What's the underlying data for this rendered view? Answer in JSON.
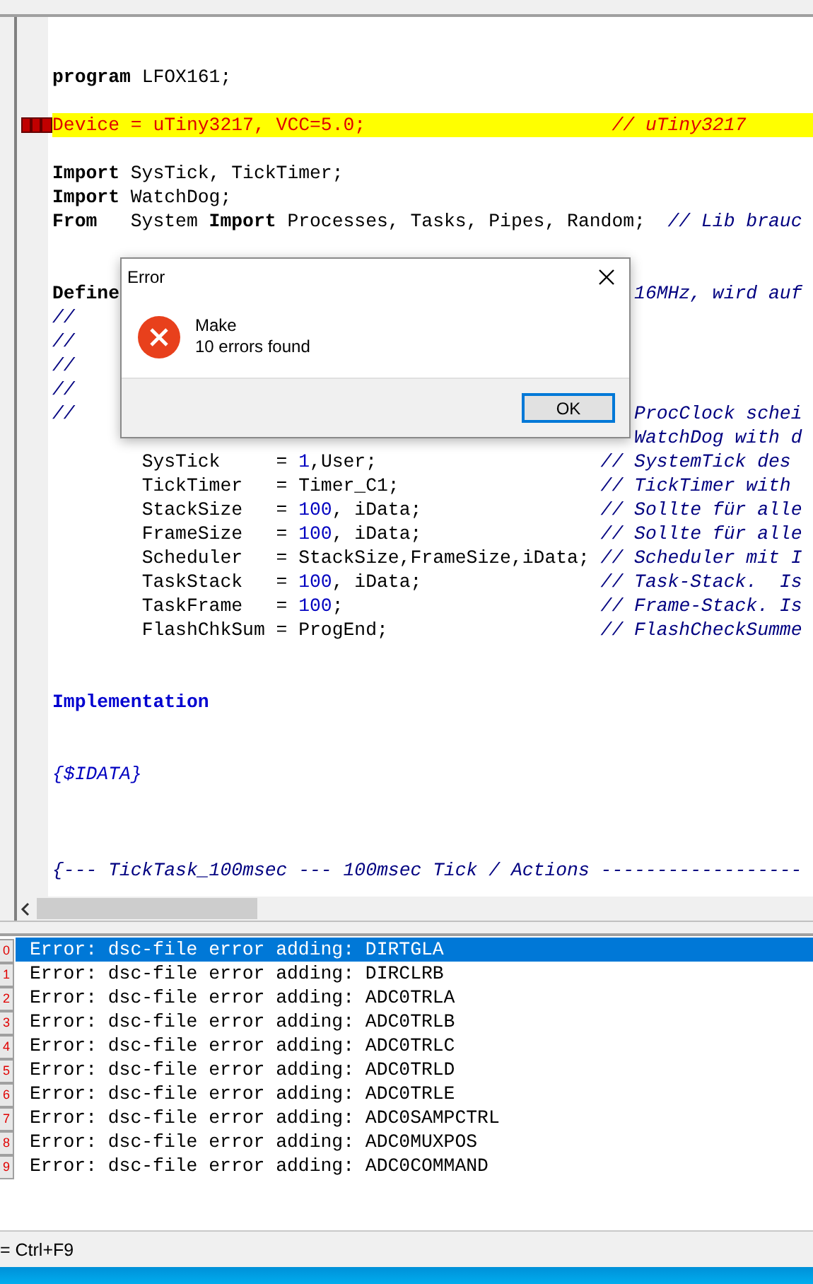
{
  "editor": {
    "lines": [
      {
        "kind": "blank"
      },
      {
        "kind": "blank"
      },
      {
        "kind": "code",
        "error": false,
        "runs": [
          {
            "parts": [
              {
                "kind": "kw",
                "text": "program"
              },
              {
                "kind": "plain",
                "text": " LFOX161;"
              }
            ]
          }
        ]
      },
      {
        "kind": "blank"
      },
      {
        "kind": "code",
        "error": true,
        "runs": [
          {
            "parts": [
              {
                "kind": "plain",
                "text": "Device = uTiny3217, VCC=5.0;                      "
              },
              {
                "kind": "cm",
                "text": "// uTiny3217"
              }
            ]
          }
        ]
      },
      {
        "kind": "blank"
      },
      {
        "kind": "code",
        "error": false,
        "runs": [
          {
            "parts": [
              {
                "kind": "kw",
                "text": "Import"
              },
              {
                "kind": "plain",
                "text": " SysTick, TickTimer;"
              }
            ]
          }
        ]
      },
      {
        "kind": "code",
        "error": false,
        "runs": [
          {
            "parts": [
              {
                "kind": "kw",
                "text": "Import"
              },
              {
                "kind": "plain",
                "text": " WatchDog;"
              }
            ]
          }
        ]
      },
      {
        "kind": "code",
        "error": false,
        "runs": [
          {
            "parts": [
              {
                "kind": "kw",
                "text": "From"
              },
              {
                "kind": "plain",
                "text": "   System "
              },
              {
                "kind": "kw",
                "text": "Import"
              },
              {
                "kind": "plain",
                "text": " Processes, Tasks, Pipes, Random;  "
              },
              {
                "kind": "cm",
                "text": "// Lib brauc"
              }
            ]
          }
        ]
      },
      {
        "kind": "blank"
      },
      {
        "kind": "blank"
      },
      {
        "kind": "code",
        "error": false,
        "runs": [
          {
            "parts": [
              {
                "kind": "kw",
                "text": "Define"
              }
            ]
          },
          {
            "parts": [
              {
                "kind": "cm",
                "text": "                                              16MHz, wird auf"
              }
            ]
          }
        ]
      },
      {
        "kind": "code",
        "error": false,
        "runs": [
          {
            "parts": [
              {
                "kind": "cm",
                "text": "//"
              }
            ]
          }
        ]
      },
      {
        "kind": "code",
        "error": false,
        "runs": [
          {
            "parts": [
              {
                "kind": "cm",
                "text": "//"
              }
            ]
          }
        ]
      },
      {
        "kind": "code",
        "error": false,
        "runs": [
          {
            "parts": [
              {
                "kind": "cm",
                "text": "//"
              }
            ]
          }
        ]
      },
      {
        "kind": "code",
        "error": false,
        "runs": [
          {
            "parts": [
              {
                "kind": "cm",
                "text": "//"
              }
            ]
          }
        ]
      },
      {
        "kind": "code",
        "error": false,
        "runs": [
          {
            "parts": [
              {
                "kind": "cm",
                "text": "//"
              }
            ]
          },
          {
            "parts": [
              {
                "kind": "cm",
                "text": "                                                  ProcClock schei"
              }
            ]
          }
        ]
      },
      {
        "kind": "code",
        "error": false,
        "runs": [
          {
            "parts": [
              {
                "kind": "cm",
                "text": "                                                    WatchDog with d"
              }
            ]
          }
        ]
      },
      {
        "kind": "code",
        "error": false,
        "runs": [
          {
            "parts": [
              {
                "kind": "plain",
                "text": "        SysTick     = "
              },
              {
                "kind": "num",
                "text": "1"
              },
              {
                "kind": "plain",
                "text": ",User;                    "
              },
              {
                "kind": "cm",
                "text": "// SystemTick des"
              }
            ]
          }
        ]
      },
      {
        "kind": "code",
        "error": false,
        "runs": [
          {
            "parts": [
              {
                "kind": "plain",
                "text": "        TickTimer   = Timer_C1;                  "
              },
              {
                "kind": "cm",
                "text": "// TickTimer with"
              }
            ]
          }
        ]
      },
      {
        "kind": "code",
        "error": false,
        "runs": [
          {
            "parts": [
              {
                "kind": "plain",
                "text": "        StackSize   = "
              },
              {
                "kind": "num",
                "text": "100"
              },
              {
                "kind": "plain",
                "text": ", iData;                "
              },
              {
                "kind": "cm",
                "text": "// Sollte für alle"
              }
            ]
          }
        ]
      },
      {
        "kind": "code",
        "error": false,
        "runs": [
          {
            "parts": [
              {
                "kind": "plain",
                "text": "        FrameSize   = "
              },
              {
                "kind": "num",
                "text": "100"
              },
              {
                "kind": "plain",
                "text": ", iData;                "
              },
              {
                "kind": "cm",
                "text": "// Sollte für alle"
              }
            ]
          }
        ]
      },
      {
        "kind": "code",
        "error": false,
        "runs": [
          {
            "parts": [
              {
                "kind": "plain",
                "text": "        Scheduler   = StackSize,FrameSize,iData; "
              },
              {
                "kind": "cm",
                "text": "// Scheduler mit I"
              }
            ]
          }
        ]
      },
      {
        "kind": "code",
        "error": false,
        "runs": [
          {
            "parts": [
              {
                "kind": "plain",
                "text": "        TaskStack   = "
              },
              {
                "kind": "num",
                "text": "100"
              },
              {
                "kind": "plain",
                "text": ", iData;                "
              },
              {
                "kind": "cm",
                "text": "// Task-Stack.  Is"
              }
            ]
          }
        ]
      },
      {
        "kind": "code",
        "error": false,
        "runs": [
          {
            "parts": [
              {
                "kind": "plain",
                "text": "        TaskFrame   = "
              },
              {
                "kind": "num",
                "text": "100"
              },
              {
                "kind": "plain",
                "text": ";                       "
              },
              {
                "kind": "cm",
                "text": "// Frame-Stack. Is"
              }
            ]
          }
        ]
      },
      {
        "kind": "code",
        "error": false,
        "runs": [
          {
            "parts": [
              {
                "kind": "plain",
                "text": "        FlashChkSum = ProgEnd;                   "
              },
              {
                "kind": "cm",
                "text": "// FlashCheckSumme"
              }
            ]
          }
        ]
      },
      {
        "kind": "blank"
      },
      {
        "kind": "blank"
      },
      {
        "kind": "code",
        "error": false,
        "runs": [
          {
            "parts": [
              {
                "kind": "kwb",
                "text": "Implementation"
              }
            ]
          }
        ]
      },
      {
        "kind": "blank"
      },
      {
        "kind": "blank"
      },
      {
        "kind": "code",
        "error": false,
        "runs": [
          {
            "parts": [
              {
                "kind": "dir",
                "text": "{$IDATA}"
              }
            ]
          }
        ]
      },
      {
        "kind": "blank"
      },
      {
        "kind": "blank"
      },
      {
        "kind": "blank"
      },
      {
        "kind": "code",
        "error": false,
        "runs": [
          {
            "parts": [
              {
                "kind": "cm",
                "text": "{--- TickTask_100msec --- 100msec Tick / Actions ------------------"
              }
            ]
          }
        ]
      }
    ]
  },
  "dialog": {
    "title": "Error",
    "heading": "Make",
    "message": "10 errors found",
    "button": "OK"
  },
  "messages": [
    {
      "index": "0",
      "text": "Error: dsc-file error adding: DIRTGLA",
      "selected": true
    },
    {
      "index": "1",
      "text": "Error: dsc-file error adding: DIRCLRB",
      "selected": false
    },
    {
      "index": "2",
      "text": "Error: dsc-file error adding: ADC0TRLA",
      "selected": false
    },
    {
      "index": "3",
      "text": "Error: dsc-file error adding: ADC0TRLB",
      "selected": false
    },
    {
      "index": "4",
      "text": "Error: dsc-file error adding: ADC0TRLC",
      "selected": false
    },
    {
      "index": "5",
      "text": "Error: dsc-file error adding: ADC0TRLD",
      "selected": false
    },
    {
      "index": "6",
      "text": "Error: dsc-file error adding: ADC0TRLE",
      "selected": false
    },
    {
      "index": "7",
      "text": "Error: dsc-file error adding: ADC0SAMPCTRL",
      "selected": false
    },
    {
      "index": "8",
      "text": "Error: dsc-file error adding: ADC0MUXPOS",
      "selected": false
    },
    {
      "index": "9",
      "text": "Error: dsc-file error adding: ADC0COMMAND",
      "selected": false
    }
  ],
  "status_bar": {
    "text": "= Ctrl+F9"
  }
}
